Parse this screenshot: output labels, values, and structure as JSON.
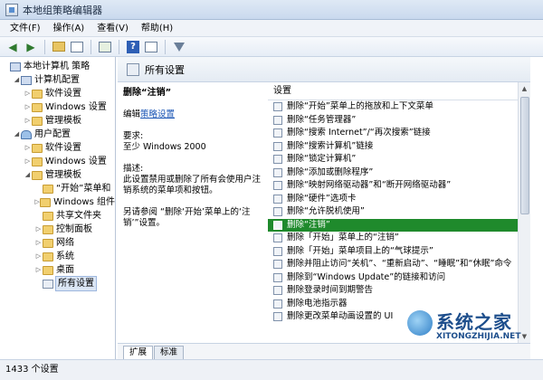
{
  "window": {
    "title": "本地组策略编辑器"
  },
  "menu": [
    "文件(F)",
    "操作(A)",
    "查看(V)",
    "帮助(H)"
  ],
  "toolbar": {
    "icons": [
      "back-arrow-icon",
      "forward-arrow-icon",
      "folder-up-icon",
      "show-hide-tree-icon",
      "export-icon",
      "help-icon",
      "properties-icon",
      "filter-icon"
    ]
  },
  "tree": [
    {
      "label": "本地计算机 策略",
      "indent": 0,
      "twisty": "",
      "icon": "pc"
    },
    {
      "label": "计算机配置",
      "indent": 1,
      "twisty": "◢",
      "icon": "pc"
    },
    {
      "label": "软件设置",
      "indent": 2,
      "twisty": "▷",
      "icon": "folder"
    },
    {
      "label": "Windows 设置",
      "indent": 2,
      "twisty": "▷",
      "icon": "folder"
    },
    {
      "label": "管理模板",
      "indent": 2,
      "twisty": "▷",
      "icon": "folder"
    },
    {
      "label": "用户配置",
      "indent": 1,
      "twisty": "◢",
      "icon": "user"
    },
    {
      "label": "软件设置",
      "indent": 2,
      "twisty": "▷",
      "icon": "folder"
    },
    {
      "label": "Windows 设置",
      "indent": 2,
      "twisty": "▷",
      "icon": "folder"
    },
    {
      "label": "管理模板",
      "indent": 2,
      "twisty": "◢",
      "icon": "folder"
    },
    {
      "label": "“开始”菜单和",
      "indent": 3,
      "twisty": "",
      "icon": "folder"
    },
    {
      "label": "Windows 组件",
      "indent": 3,
      "twisty": "▷",
      "icon": "folder"
    },
    {
      "label": "共享文件夹",
      "indent": 3,
      "twisty": "",
      "icon": "folder"
    },
    {
      "label": "控制面板",
      "indent": 3,
      "twisty": "▷",
      "icon": "folder"
    },
    {
      "label": "网络",
      "indent": 3,
      "twisty": "▷",
      "icon": "folder"
    },
    {
      "label": "系统",
      "indent": 3,
      "twisty": "▷",
      "icon": "folder"
    },
    {
      "label": "桌面",
      "indent": 3,
      "twisty": "▷",
      "icon": "folder"
    },
    {
      "label": "所有设置",
      "indent": 3,
      "twisty": "",
      "icon": "policy",
      "selected": true
    }
  ],
  "detail": {
    "header": "所有设置",
    "title": "删除“注销”",
    "edit_prefix": "编辑",
    "edit_link": "策略设置",
    "requirements_label": "要求:",
    "requirements_value": "至少 Windows 2000",
    "description_label": "描述:",
    "description_text": "此设置禁用或删除了所有会使用户注销系统的菜单项和按钮。",
    "see_also": "另请参阅 “删除‘开始’菜单上的‘注销’”设置。"
  },
  "settings": {
    "column_header": "设置",
    "items": [
      "删除“开始”菜单上的拖放和上下文菜单",
      "删除“任务管理器”",
      "删除“搜索 Internet”/“再次搜索”链接",
      "删除“搜索计算机”链接",
      "删除“锁定计算机”",
      "删除“添加或删除程序”",
      "删除“映射网络驱动器”和“断开网络驱动器”",
      "删除“硬件”选项卡",
      "删除“允许脱机使用”",
      "删除“注销”",
      "删除「开始」菜单上的“注销”",
      "删除「开始」菜单项目上的“气球提示”",
      "删除并阻止访问“关机”、“重新启动”、“睡眠”和“休眠”命令",
      "删除到“Windows Update”的链接和访问",
      "删除登录时间到期警告",
      "删除电池指示器",
      "删除更改菜单动画设置的 UI"
    ],
    "selected_index": 9
  },
  "tabs": [
    "扩展",
    "标准"
  ],
  "active_tab": 0,
  "status": "1433 个设置",
  "watermark": {
    "title": "系统之家",
    "url": "XITONGZHIJIA.NET"
  }
}
